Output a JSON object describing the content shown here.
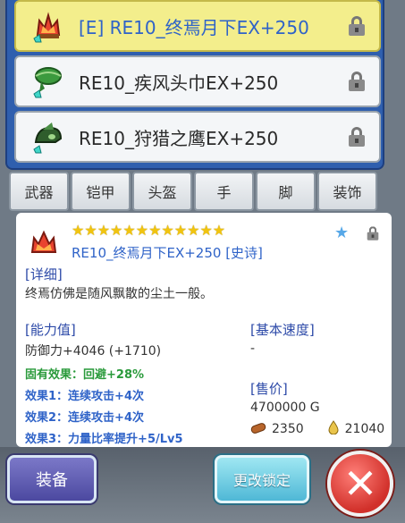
{
  "items": [
    {
      "name": "[E] RE10_终焉月下EX+250",
      "icon": "crown-fire-icon",
      "selected": true
    },
    {
      "name": "RE10_疾风头巾EX+250",
      "icon": "headband-icon",
      "selected": false
    },
    {
      "name": "RE10_狩猎之鹰EX+250",
      "icon": "hawk-helmet-icon",
      "selected": false
    }
  ],
  "tabs": [
    "武器",
    "铠甲",
    "头盔",
    "手",
    "脚",
    "装饰"
  ],
  "detail": {
    "stars": "★★★★★★★★★★★★",
    "title": "RE10_终焉月下EX+250 [史诗]",
    "detail_header": "[详细]",
    "description": "终焉仿佛是随风飘散的尘土一般。",
    "ability_header": "[能力值]",
    "defense": "防御力+4046 (+1710)",
    "inherent": "固有效果：回避+28%",
    "effect1": "效果1：连续攻击+4次",
    "effect2": "效果2：连续攻击+4次",
    "effect3": "效果3：力量比率提升+5/Lv5",
    "speed_header": "[基本速度]",
    "speed_value": "-",
    "price_header": "[售价]",
    "price_gold": "4700000 G",
    "material1": "2350",
    "material2": "21040"
  },
  "buttons": {
    "equip": "装备",
    "change_lock": "更改锁定"
  },
  "colors": {
    "panel_blue": "#2f5fae",
    "selected_bg": "#f3ee8c",
    "accent_blue": "#2f63c8",
    "effect_green": "#2a9a3b"
  }
}
